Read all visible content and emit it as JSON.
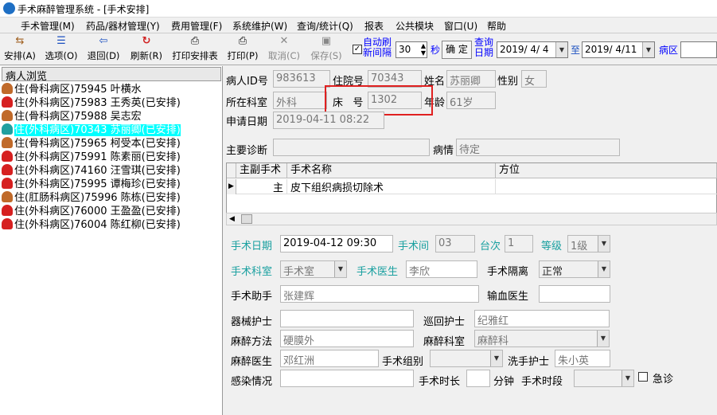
{
  "window": {
    "title": "手术麻醉管理系统 - [手术安排]"
  },
  "menu": [
    "手术管理(M)",
    "药品/器材管理(Y)",
    "费用管理(F)",
    "系统维护(W)",
    "查询/统计(Q)",
    "报表",
    "公共模块",
    "窗口(U)",
    "帮助"
  ],
  "toolbar": {
    "arrange": "安排(A)",
    "options": "选项(O)",
    "back": "退回(D)",
    "refresh": "刷新(R)",
    "print_list": "打印安排表",
    "print": "打印(P)",
    "cancel": "取消(C)",
    "save": "保存(S)",
    "auto_refresh_label": "自动刷新间隔",
    "auto_refresh_value": "30",
    "seconds": "秒",
    "confirm": "确 定",
    "query_date_label": "查询日期",
    "date_from": "2019/ 4/ 4",
    "to": "至",
    "date_to": "2019/ 4/11",
    "ward_label": "病区"
  },
  "patient_list": {
    "header": "病人浏览",
    "items": [
      {
        "text": "住(骨科病区)75945 叶横水",
        "icon": "male-patient-icon",
        "color": "#c06a2a",
        "selected": false
      },
      {
        "text": "住(外科病区)75983 王秀英(已安排)",
        "icon": "female-patient-icon",
        "color": "#d62020",
        "selected": false
      },
      {
        "text": "住(骨科病区)75988 吴志宏",
        "icon": "male-patient-icon",
        "color": "#c06a2a",
        "selected": false
      },
      {
        "text": "住(外科病区)70343 苏丽卿(已安排)",
        "icon": "female-patient-icon",
        "color": "#20a0a0",
        "selected": true
      },
      {
        "text": "住(骨科病区)75965 柯受本(已安排)",
        "icon": "male-patient-icon",
        "color": "#c06a2a",
        "selected": false
      },
      {
        "text": "住(外科病区)75991 陈素丽(已安排)",
        "icon": "female-patient-icon",
        "color": "#d62020",
        "selected": false
      },
      {
        "text": "住(外科病区)74160 汪雪琪(已安排)",
        "icon": "female-patient-icon",
        "color": "#d62020",
        "selected": false
      },
      {
        "text": "住(外科病区)75995 谭梅珍(已安排)",
        "icon": "female-patient-icon",
        "color": "#d62020",
        "selected": false
      },
      {
        "text": "住(肛肠科病区)75996 陈栋(已安排)",
        "icon": "male-patient-icon",
        "color": "#c06a2a",
        "selected": false
      },
      {
        "text": "住(外科病区)76000 王盈盈(已安排)",
        "icon": "female-patient-icon",
        "color": "#d62020",
        "selected": false
      },
      {
        "text": "住(外科病区)76004 陈红柳(已安排)",
        "icon": "female-patient-icon",
        "color": "#d62020",
        "selected": false
      }
    ]
  },
  "patient_info": {
    "id_label": "病人ID号",
    "id_value": "983613",
    "admission_label": "住院号",
    "admission_value": "70343",
    "name_label": "姓名",
    "name_value": "苏丽卿",
    "gender_label": "性别",
    "gender_value": "女",
    "dept_label": "所在科室",
    "dept_value": "外科",
    "bed_label": "床   号",
    "bed_value": "1302",
    "age_label": "年龄",
    "age_value": "61岁",
    "apply_label": "申请日期",
    "apply_value": "2019-04-11 08:22",
    "diag_label": "主要诊断",
    "diag_value": "",
    "cond_label": "病情",
    "cond_value": "待定"
  },
  "surgery_grid": {
    "columns": [
      "主副手术",
      "手术名称",
      "方位"
    ],
    "rows": [
      {
        "type": "主",
        "name": "皮下组织病损切除术",
        "position": ""
      }
    ]
  },
  "surgery_form": {
    "date_label": "手术日期",
    "date_value": "2019-04-12 09:30",
    "room_label": "手术间",
    "room_value": "03",
    "order_label": "台次",
    "order_value": "1",
    "level_label": "等级",
    "level_value": "1级",
    "dept_label": "手术科室",
    "dept_value": "手术室",
    "doctor_label": "手术医生",
    "doctor_value": "李欣",
    "isolation_label": "手术隔离",
    "isolation_value": "正常",
    "assistant_label": "手术助手",
    "assistant_value": "张建辉",
    "transfusion_label": "输血医生",
    "transfusion_value": "",
    "instrument_nurse_label": "器械护士",
    "instrument_nurse_value": "",
    "circulating_nurse_label": "巡回护士",
    "circulating_nurse_value": "纪雅红",
    "anes_method_label": "麻醉方法",
    "anes_method_value": "硬膜外",
    "anes_dept_label": "麻醉科室",
    "anes_dept_value": "麻醉科",
    "anes_doctor_label": "麻醉医生",
    "anes_doctor_value": "邓红洲",
    "group_label": "手术组别",
    "group_value": "",
    "hand_nurse_label": "洗手护士",
    "hand_nurse_value": "朱小英",
    "infection_label": "感染情况",
    "infection_value": "",
    "duration_label": "手术时长",
    "duration_value": "",
    "minutes_label": "分钟",
    "period_label": "手术时段",
    "period_value": "",
    "emergency_label": "急诊"
  }
}
